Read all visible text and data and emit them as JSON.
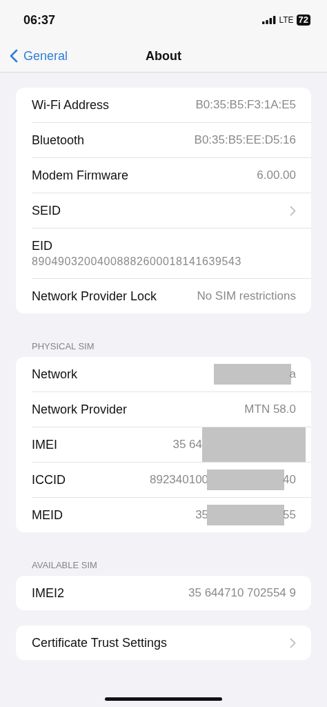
{
  "status_bar": {
    "time": "06:37",
    "network": "LTE",
    "battery": "72"
  },
  "nav": {
    "back": "General",
    "title": "About"
  },
  "sections": [
    {
      "rows": [
        {
          "kind": "value",
          "label": "Wi-Fi Address",
          "value": "B0:35:B5:F3:1A:E5"
        },
        {
          "kind": "value",
          "label": "Bluetooth",
          "value": "B0:35:B5:EE:D5:16"
        },
        {
          "kind": "value",
          "label": "Modem Firmware",
          "value": "6.00.00"
        },
        {
          "kind": "link",
          "label": "SEID"
        },
        {
          "kind": "stacked",
          "label": "EID",
          "value": "89049032004008882600018141639543"
        },
        {
          "kind": "value",
          "label": "Network Provider Lock",
          "value": "No SIM restrictions"
        }
      ]
    },
    {
      "header": "PHYSICAL SIM",
      "rows": [
        {
          "kind": "redacted",
          "label": "Network",
          "value_start": "",
          "value_end": "a"
        },
        {
          "kind": "value",
          "label": "Network Provider",
          "value": "MTN 58.0"
        },
        {
          "kind": "covered",
          "label": "IMEI",
          "value_start": "35 64",
          "value_end": ""
        },
        {
          "kind": "redacted",
          "label": "ICCID",
          "value_start": "892340100",
          "value_end": "40"
        },
        {
          "kind": "redacted",
          "label": "MEID",
          "value_start": "35",
          "value_end": "55"
        }
      ]
    },
    {
      "header": "AVAILABLE SIM",
      "rows": [
        {
          "kind": "value",
          "label": "IMEI2",
          "value": "35 644710 702554 9"
        }
      ]
    },
    {
      "rows": [
        {
          "kind": "link",
          "label": "Certificate Trust Settings"
        }
      ]
    }
  ]
}
